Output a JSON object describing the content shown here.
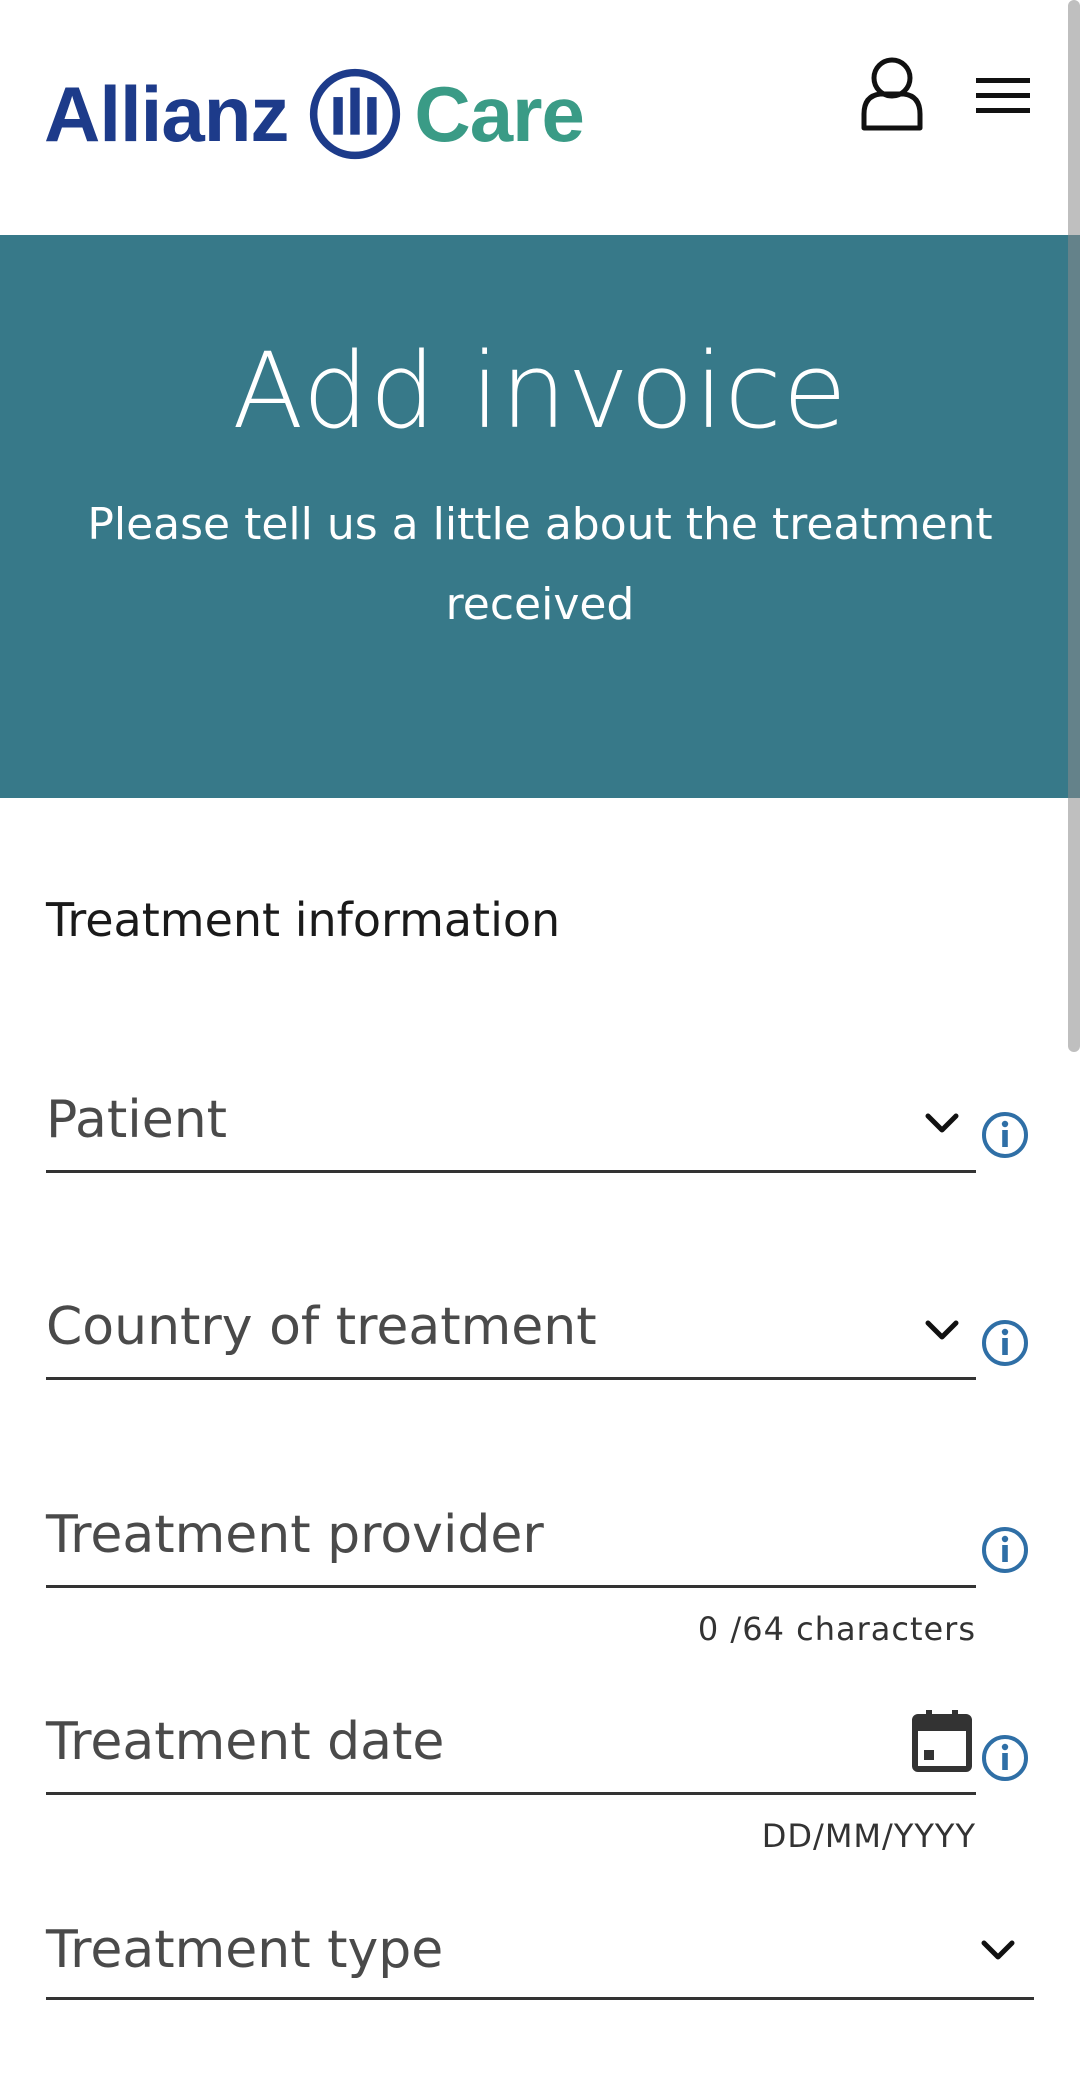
{
  "header": {
    "brand_name": "Allianz",
    "brand_product": "Care",
    "icons": {
      "user": "user-icon",
      "menu": "hamburger-menu-icon",
      "logo": "allianz-eagle-logo"
    }
  },
  "banner": {
    "title": "Add invoice",
    "subtitle": "Please tell us a little about the treatment received"
  },
  "form": {
    "section_title": "Treatment information",
    "fields": {
      "patient": {
        "placeholder": "Patient",
        "type": "dropdown"
      },
      "country": {
        "placeholder": "Country of treatment",
        "type": "dropdown"
      },
      "provider": {
        "placeholder": "Treatment provider",
        "counter": "0 /64 characters",
        "type": "text"
      },
      "date": {
        "placeholder": "Treatment date",
        "format_hint": "DD/MM/YYYY",
        "type": "date"
      },
      "type": {
        "placeholder": "Treatment type",
        "type": "dropdown"
      }
    }
  },
  "colors": {
    "banner": "#377989",
    "brand_blue": "#1d3b8a",
    "brand_teal": "#3a9b86",
    "info_blue": "#2f6fa6"
  }
}
